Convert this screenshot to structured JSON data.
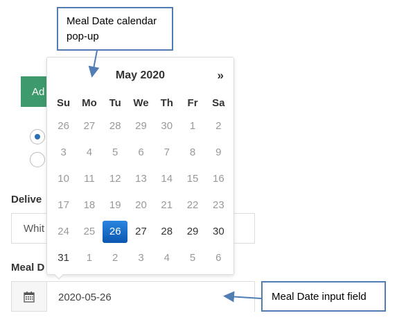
{
  "background": {
    "add_button_label": "Ad",
    "delivery_label": "Delive",
    "delivery_select_value": "Whit",
    "meal_date_label": "Meal D",
    "meal_date_input": {
      "value": "2020-05-26",
      "icon": "calendar-icon"
    }
  },
  "calendar": {
    "title": "May 2020",
    "next_label": "»",
    "weekdays": [
      "Su",
      "Mo",
      "Tu",
      "We",
      "Th",
      "Fr",
      "Sa"
    ],
    "weeks": [
      [
        {
          "d": "26",
          "m": true
        },
        {
          "d": "27",
          "m": true
        },
        {
          "d": "28",
          "m": true
        },
        {
          "d": "29",
          "m": true
        },
        {
          "d": "30",
          "m": true
        },
        {
          "d": "1",
          "m": true
        },
        {
          "d": "2",
          "m": true
        }
      ],
      [
        {
          "d": "3",
          "m": true
        },
        {
          "d": "4",
          "m": true
        },
        {
          "d": "5",
          "m": true
        },
        {
          "d": "6",
          "m": true
        },
        {
          "d": "7",
          "m": true
        },
        {
          "d": "8",
          "m": true
        },
        {
          "d": "9",
          "m": true
        }
      ],
      [
        {
          "d": "10",
          "m": true
        },
        {
          "d": "11",
          "m": true
        },
        {
          "d": "12",
          "m": true
        },
        {
          "d": "13",
          "m": true
        },
        {
          "d": "14",
          "m": true
        },
        {
          "d": "15",
          "m": true
        },
        {
          "d": "16",
          "m": true
        }
      ],
      [
        {
          "d": "17",
          "m": true
        },
        {
          "d": "18",
          "m": true
        },
        {
          "d": "19",
          "m": true
        },
        {
          "d": "20",
          "m": true
        },
        {
          "d": "21",
          "m": true
        },
        {
          "d": "22",
          "m": true
        },
        {
          "d": "23",
          "m": true
        }
      ],
      [
        {
          "d": "24",
          "m": true
        },
        {
          "d": "25",
          "m": true
        },
        {
          "d": "26",
          "m": false,
          "active": true
        },
        {
          "d": "27",
          "m": false
        },
        {
          "d": "28",
          "m": false
        },
        {
          "d": "29",
          "m": false
        },
        {
          "d": "30",
          "m": false
        }
      ],
      [
        {
          "d": "31",
          "m": false
        },
        {
          "d": "1",
          "m": true
        },
        {
          "d": "2",
          "m": true
        },
        {
          "d": "3",
          "m": true
        },
        {
          "d": "4",
          "m": true
        },
        {
          "d": "5",
          "m": true
        },
        {
          "d": "6",
          "m": true
        }
      ]
    ],
    "accent_color": "#1769c4"
  },
  "annotations": {
    "popup_callout": "Meal Date calendar pop-up",
    "input_callout": "Meal Date input field"
  }
}
